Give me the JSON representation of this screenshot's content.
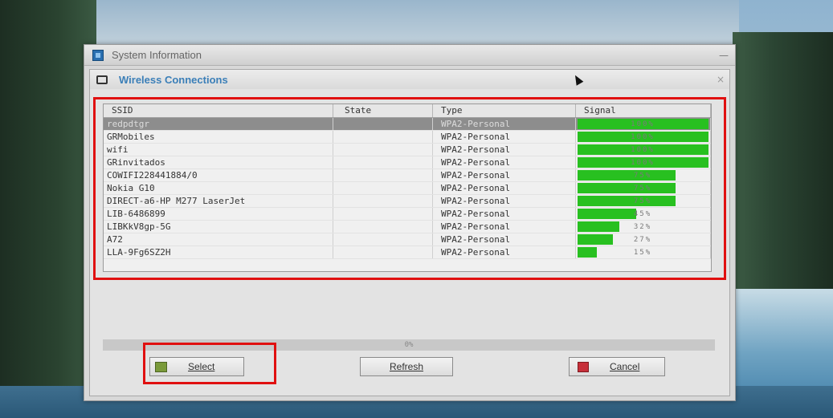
{
  "window": {
    "title": "System Information",
    "minimize_glyph": "—"
  },
  "dialog": {
    "title": "Wireless Connections",
    "close_glyph": "×"
  },
  "table": {
    "headers": {
      "ssid": "SSID",
      "state": "State",
      "type": "Type",
      "signal": "Signal"
    },
    "rows": [
      {
        "ssid": "redpdtgr",
        "state": "",
        "type": "WPA2-Personal",
        "signal": 100,
        "signal_label": "100%",
        "selected": true
      },
      {
        "ssid": "GRMobiles",
        "state": "",
        "type": "WPA2-Personal",
        "signal": 100,
        "signal_label": "100%"
      },
      {
        "ssid": "wifi",
        "state": "",
        "type": "WPA2-Personal",
        "signal": 100,
        "signal_label": "100%"
      },
      {
        "ssid": "GRinvitados",
        "state": "",
        "type": "WPA2-Personal",
        "signal": 100,
        "signal_label": "100%"
      },
      {
        "ssid": "COWIFI228441884/0",
        "state": "",
        "type": "WPA2-Personal",
        "signal": 75,
        "signal_label": "75%"
      },
      {
        "ssid": "Nokia G10",
        "state": "",
        "type": "WPA2-Personal",
        "signal": 75,
        "signal_label": "75%"
      },
      {
        "ssid": "DIRECT-a6-HP M277 LaserJet",
        "state": "",
        "type": "WPA2-Personal",
        "signal": 75,
        "signal_label": "75%"
      },
      {
        "ssid": "LIB-6486899",
        "state": "",
        "type": "WPA2-Personal",
        "signal": 45,
        "signal_label": "45%"
      },
      {
        "ssid": "LIBKkV8gp-5G",
        "state": "",
        "type": "WPA2-Personal",
        "signal": 32,
        "signal_label": "32%"
      },
      {
        "ssid": "A72",
        "state": "",
        "type": "WPA2-Personal",
        "signal": 27,
        "signal_label": "27%"
      },
      {
        "ssid": "LLA-9Fg6SZ2H",
        "state": "",
        "type": "WPA2-Personal",
        "signal": 15,
        "signal_label": "15%"
      }
    ]
  },
  "status": "0%",
  "buttons": {
    "select": "Select",
    "refresh": "Refresh",
    "cancel": "Cancel"
  },
  "colors": {
    "signal_bar": "#28c020",
    "highlight": "#e01010",
    "dialog_title": "#3b7fb8"
  },
  "icons": {
    "app": "system-info-icon",
    "dialog": "monitor-icon",
    "select": "checkmark-icon",
    "cancel": "cancel-icon"
  }
}
